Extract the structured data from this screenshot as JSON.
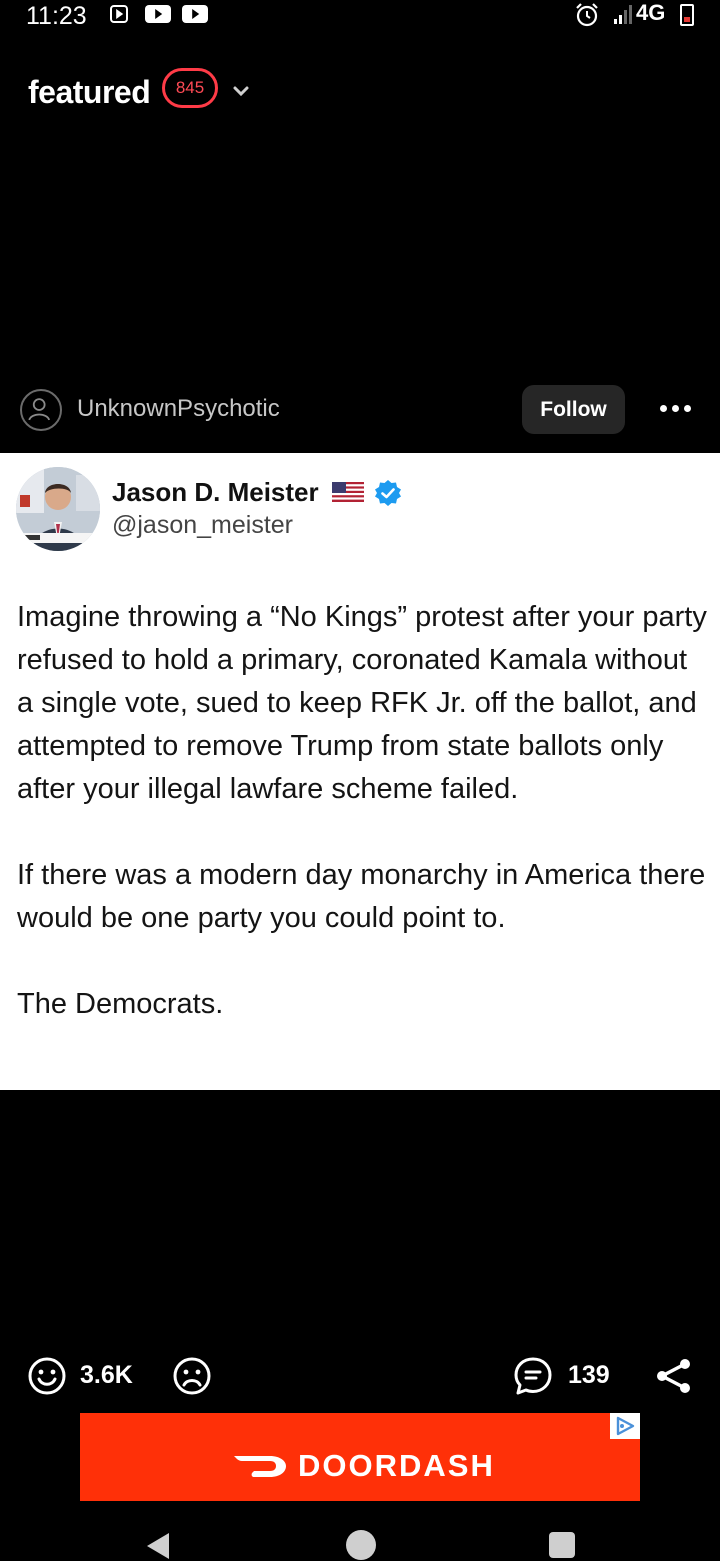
{
  "status_bar": {
    "time": "11:23",
    "network": "4G",
    "icons": [
      "media-icon",
      "youtube-icon",
      "youtube-icon",
      "alarm-icon",
      "signal-icon",
      "battery-icon"
    ]
  },
  "header": {
    "title": "featured",
    "count": "845"
  },
  "post": {
    "username": "UnknownPsychotic",
    "follow_label": "Follow"
  },
  "tweet": {
    "name": "Jason D. Meister",
    "handle": "@jason_meister",
    "paragraphs": [
      "Imagine throwing a “No Kings” protest after your party refused to hold a primary, coronated Kamala without a single vote, sued to keep RFK Jr. off the ballot, and attempted to remove Trump from state ballots only after your illegal lawfare scheme failed.",
      "If there was a modern day monarchy in America there would be one party you could point to.",
      "The Democrats."
    ],
    "verified_color": "#1d9bf0"
  },
  "actions": {
    "upvotes": "3.6K",
    "comments": "139"
  },
  "ad": {
    "brand": "DOORDASH",
    "color": "#ff3008"
  },
  "colors": {
    "badge": "#ff3b47",
    "background": "#000000"
  }
}
